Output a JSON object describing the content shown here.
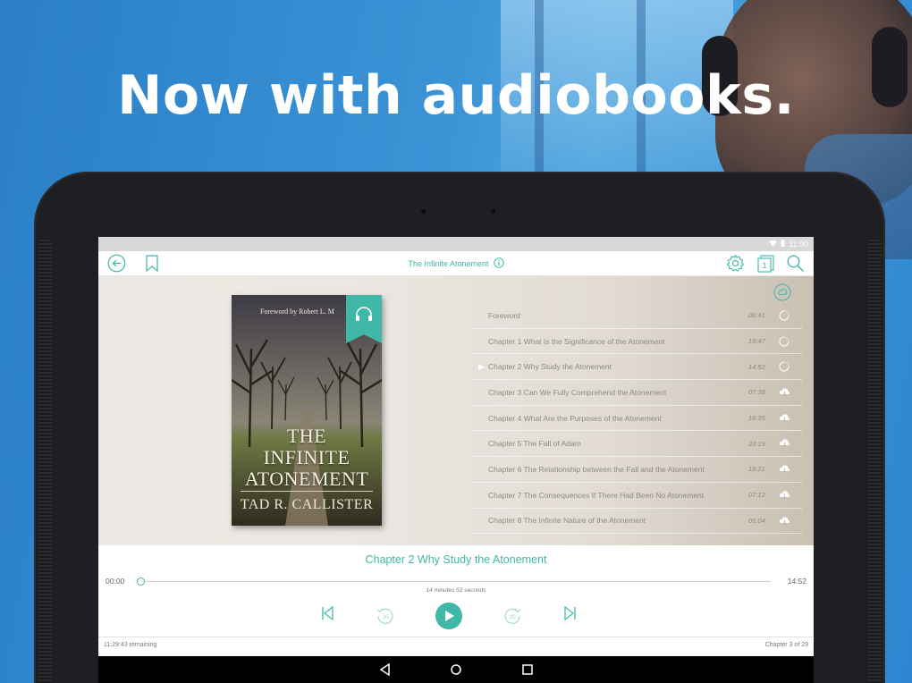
{
  "headline": "Now with audiobooks.",
  "status_bar": {
    "time": "11:00"
  },
  "app_bar": {
    "title": "The Infinite Atonement",
    "icons": [
      "back-icon",
      "bookmark-icon",
      "info-icon",
      "settings-icon",
      "chapter-pages-icon",
      "search-icon"
    ],
    "page_badge": "1"
  },
  "cover": {
    "foreword": "Foreword by Robert L. M",
    "title_line1": "THE",
    "title_line2": "INFINITE",
    "title_line3": "ATONEMENT",
    "author": "TAD R. CALLISTER",
    "badge_icon": "headphones-icon"
  },
  "chapters": [
    {
      "label": "Foreword",
      "duration": "06:41",
      "state": "downloaded"
    },
    {
      "label": "Chapter 1 What Is the Significance of the Atonement",
      "duration": "19:47",
      "state": "downloaded"
    },
    {
      "label": "Chapter 2 Why Study the Atonement",
      "duration": "14:52",
      "state": "playing"
    },
    {
      "label": "Chapter 3 Can We Fully Comprehend the Atonement",
      "duration": "07:38",
      "state": "cloud"
    },
    {
      "label": "Chapter 4 What Are the Purposes of the Atonement",
      "duration": "16:35",
      "state": "cloud"
    },
    {
      "label": "Chapter 5 The Fall of Adam",
      "duration": "23:19",
      "state": "cloud"
    },
    {
      "label": "Chapter 6 The Relationship between the Fall and the Atonement",
      "duration": "18:21",
      "state": "cloud"
    },
    {
      "label": "Chapter 7 The Consequences If There Had Been No Atonement",
      "duration": "07:12",
      "state": "cloud"
    },
    {
      "label": "Chapter 8 The Infinite Nature of the Atonement",
      "duration": "05:04",
      "state": "cloud"
    }
  ],
  "player": {
    "now_playing": "Chapter 2 Why Study the Atonement",
    "elapsed": "00:00",
    "total": "14:52",
    "remaining_text": "14 minutes 52 seconds",
    "progress": 0,
    "skip_back_seconds": "30",
    "skip_forward_seconds": "30",
    "book_remaining": "11:29:43 remaining",
    "chapter_position": "Chapter 3 of 29"
  },
  "colors": {
    "accent": "#3fb8a8",
    "background": "#3b93d6"
  }
}
